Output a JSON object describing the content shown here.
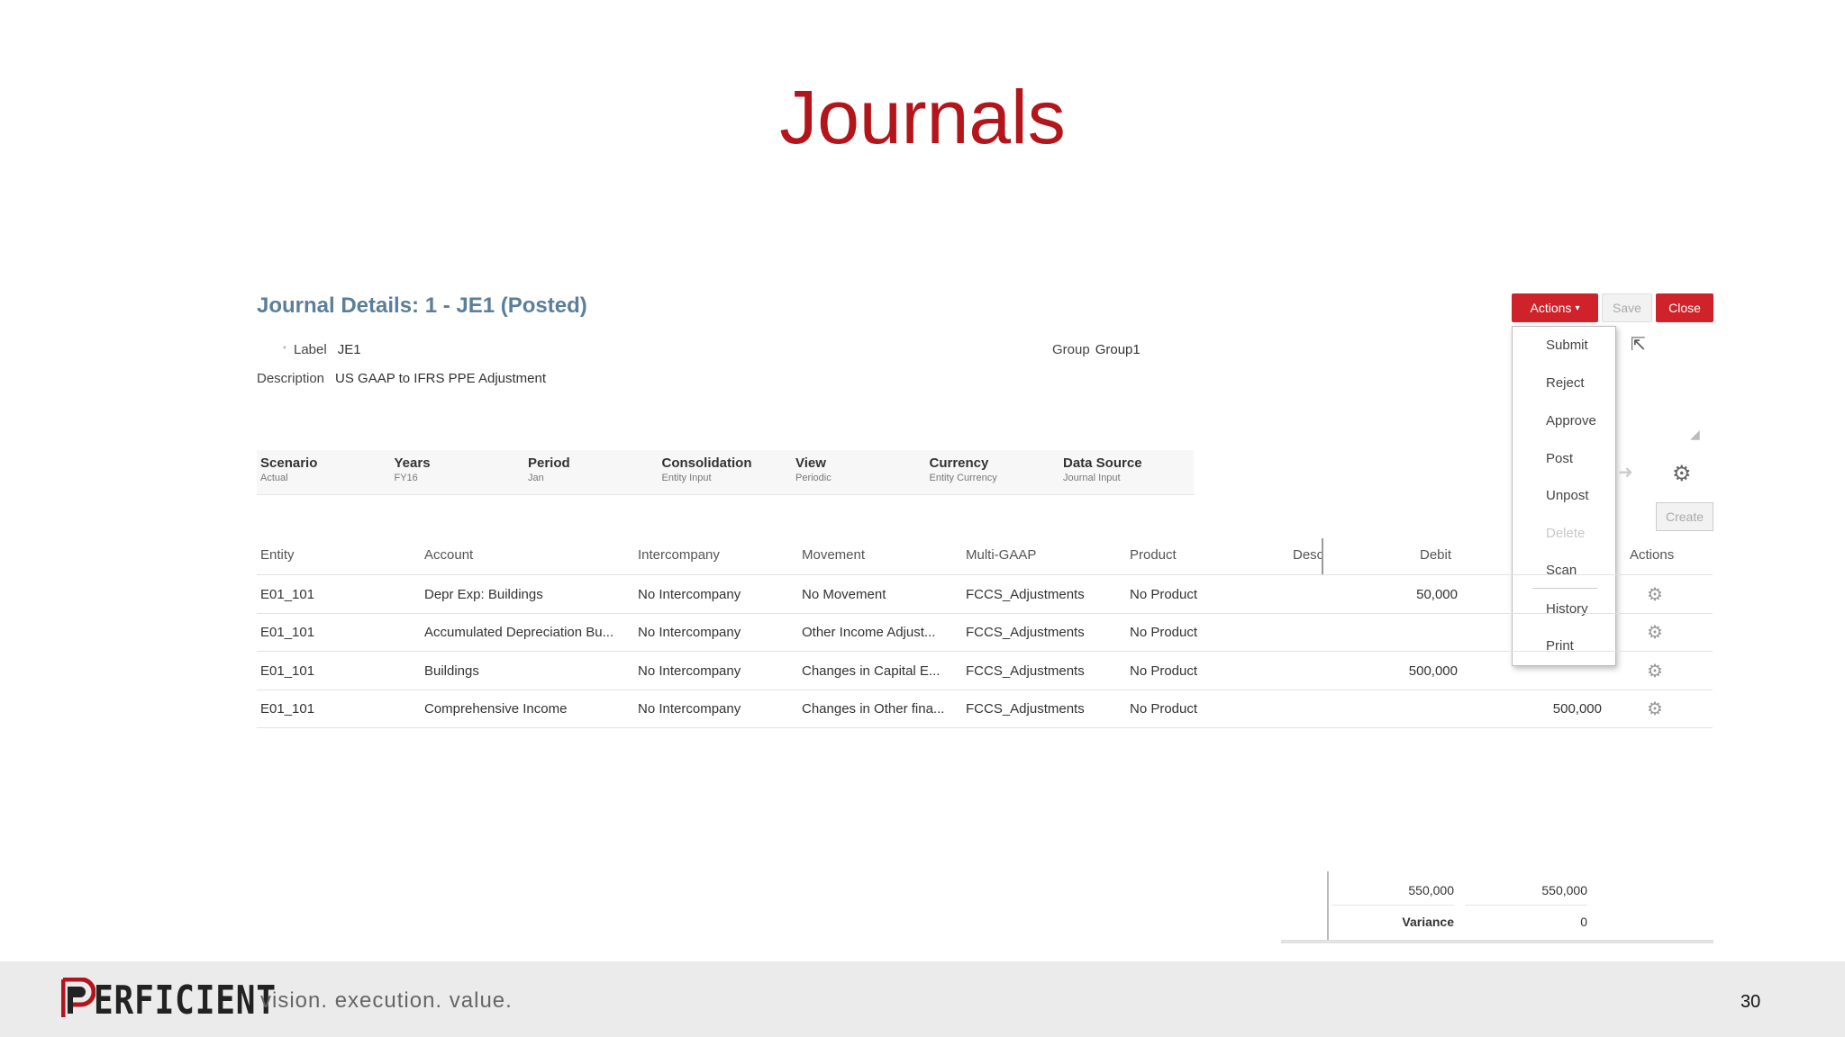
{
  "slide": {
    "title": "Journals",
    "page_number": "30"
  },
  "journal": {
    "title": "Journal Details: 1 - JE1 (Posted)",
    "label_caption": "Label",
    "label_value": "JE1",
    "group_caption": "Group",
    "group_value": "Group1",
    "description_caption": "Description",
    "description_value": "US GAAP to IFRS PPE Adjustment"
  },
  "toolbar": {
    "actions_label": "Actions",
    "save_label": "Save",
    "close_label": "Close",
    "create_label": "Create"
  },
  "actions_menu": {
    "items": [
      {
        "label": "Submit"
      },
      {
        "label": "Reject"
      },
      {
        "label": "Approve"
      },
      {
        "label": "Post"
      },
      {
        "label": "Unpost"
      },
      {
        "label": "Delete"
      },
      {
        "label": "Scan"
      },
      {
        "label": "History"
      },
      {
        "label": "Print"
      }
    ]
  },
  "pov": [
    {
      "label": "Scenario",
      "value": "Actual"
    },
    {
      "label": "Years",
      "value": "FY16"
    },
    {
      "label": "Period",
      "value": "Jan"
    },
    {
      "label": "Consolidation",
      "value": "Entity Input"
    },
    {
      "label": "View",
      "value": "Periodic"
    },
    {
      "label": "Currency",
      "value": "Entity Currency"
    },
    {
      "label": "Data Source",
      "value": "Journal Input"
    }
  ],
  "grid": {
    "headers": {
      "entity": "Entity",
      "account": "Account",
      "intercompany": "Intercompany",
      "movement": "Movement",
      "multigaap": "Multi-GAAP",
      "product": "Product",
      "description": "Desc",
      "debit": "Debit",
      "actions": "Actions"
    },
    "rows": [
      {
        "entity": "E01_101",
        "account": "Depr Exp: Buildings",
        "intercompany": "No Intercompany",
        "movement": "No Movement",
        "multigaap": "FCCS_Adjustments",
        "product": "No Product",
        "debit": "50,000",
        "credit": ""
      },
      {
        "entity": "E01_101",
        "account": "Accumulated Depreciation Bu...",
        "intercompany": "No Intercompany",
        "movement": "Other Income Adjust...",
        "multigaap": "FCCS_Adjustments",
        "product": "No Product",
        "debit": "",
        "credit": ""
      },
      {
        "entity": "E01_101",
        "account": "Buildings",
        "intercompany": "No Intercompany",
        "movement": "Changes in Capital E...",
        "multigaap": "FCCS_Adjustments",
        "product": "No Product",
        "debit": "500,000",
        "credit": ""
      },
      {
        "entity": "E01_101",
        "account": "Comprehensive Income",
        "intercompany": "No Intercompany",
        "movement": "Changes in Other fina...",
        "multigaap": "FCCS_Adjustments",
        "product": "No Product",
        "debit": "",
        "credit": "500,000"
      }
    ]
  },
  "totals": {
    "debit_total": "550,000",
    "credit_total": "550,000",
    "variance_label": "Variance",
    "variance_value": "0"
  },
  "footer": {
    "logo_text": "ERFICIENT",
    "tagline": "vision.  execution.  value."
  },
  "colors": {
    "brand_red": "#b3151b",
    "button_red": "#d0222a",
    "title_blue": "#5b7f9b"
  }
}
